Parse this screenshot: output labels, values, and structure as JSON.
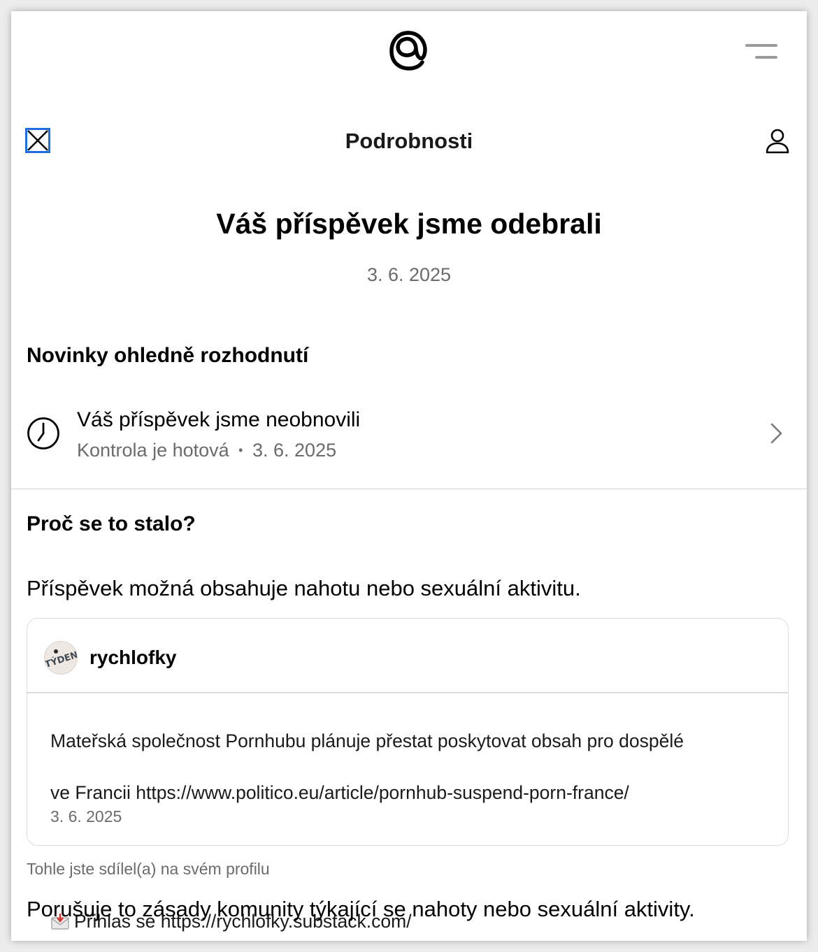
{
  "header": {
    "logo_icon": "threads-logo-icon",
    "menu_icon": "menu-icon"
  },
  "nav": {
    "close_icon": "close-icon",
    "title": "Podrobnosti",
    "profile_icon": "person-icon"
  },
  "main": {
    "heading": "Váš příspěvek jsme odebrali",
    "date": "3. 6. 2025"
  },
  "updates": {
    "heading": "Novinky ohledně rozhodnutí",
    "item": {
      "icon": "clock-icon",
      "title": "Váš příspěvek jsme neobnovili",
      "status": "Kontrola je hotová",
      "separator": "•",
      "date": "3. 6. 2025",
      "chevron_icon": "chevron-right-icon"
    }
  },
  "why": {
    "heading": "Proč se to stalo?",
    "reason": "Příspěvek možná obsahuje nahotu nebo sexuální aktivitu.",
    "post": {
      "username": "rychlofky",
      "avatar_icon": "avatar-image",
      "line1": "Mateřská společnost Pornhubu plánuje přestat poskytovat obsah pro dospělé",
      "line2": "ve Francii https://www.politico.eu/article/pornhub-suspend-porn-france/",
      "line3_emoji": "📩",
      "line3": "Přihlas se https://rychlofky.substack.com/",
      "date": "3. 6. 2025"
    },
    "shared_note": "Tohle jste sdílel(a) na svém profilu",
    "policy": "Porušuje to zásady komunity týkající se nahoty nebo sexuální aktivity."
  },
  "colors": {
    "focus_outline": "#1f6ee0",
    "secondary_text": "#6b6b6b",
    "divider": "#d4d4d4"
  }
}
